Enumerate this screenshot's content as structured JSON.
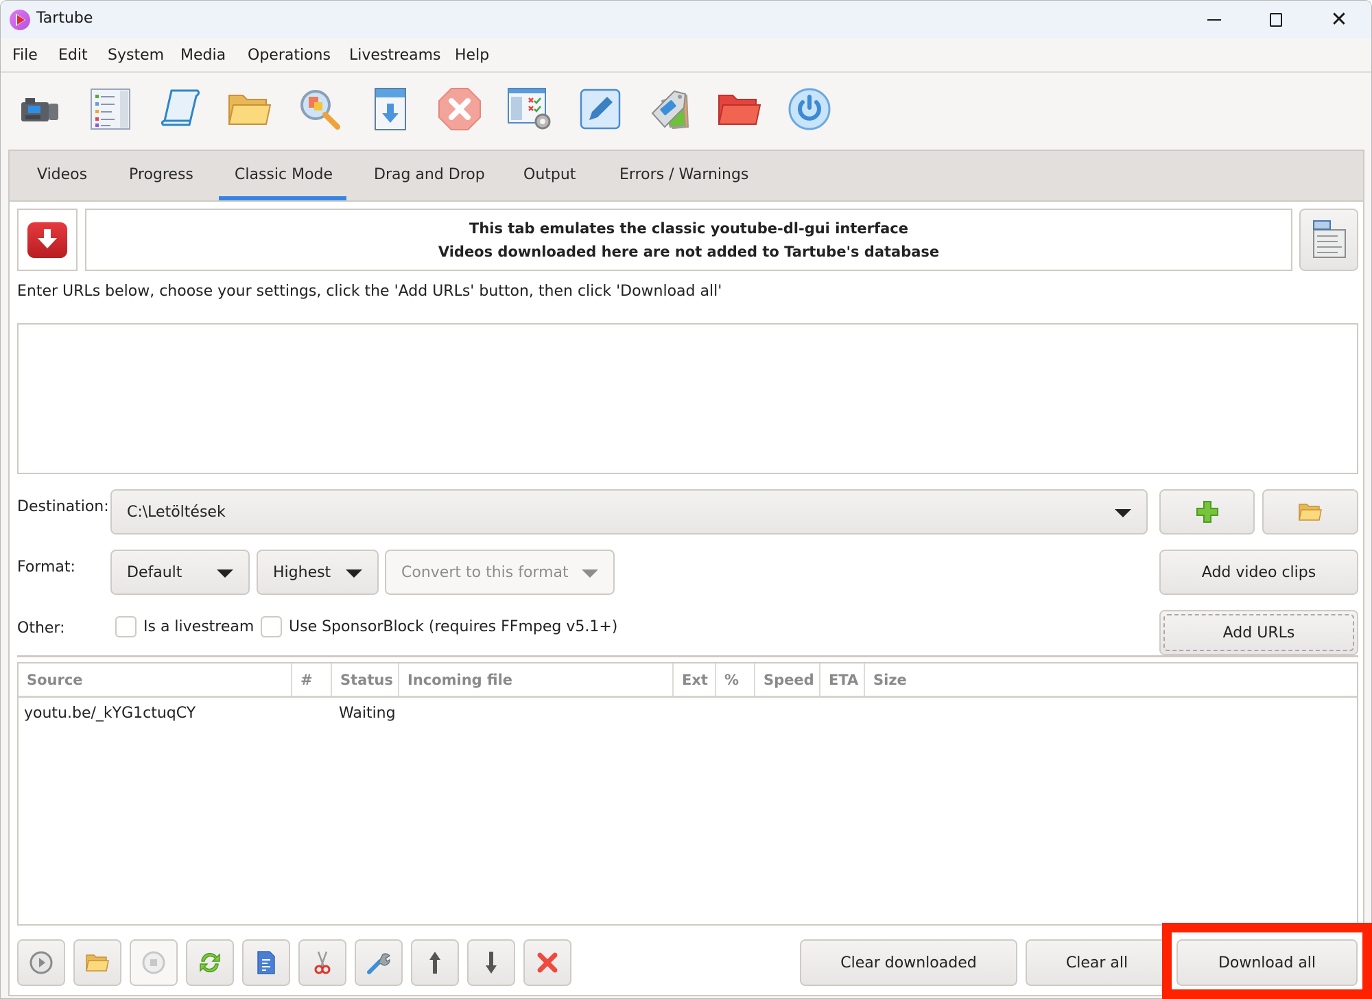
{
  "window": {
    "title": "Tartube",
    "controls": {
      "minimize": "minimize",
      "maximize": "maximize",
      "close": "✕"
    }
  },
  "menubar": [
    "File",
    "Edit",
    "System",
    "Media",
    "Operations",
    "Livestreams",
    "Help"
  ],
  "toolbar": [
    {
      "icon": "video-camera-icon"
    },
    {
      "icon": "video-list-icon"
    },
    {
      "icon": "scroll-icon"
    },
    {
      "icon": "folder-icon"
    },
    {
      "icon": "magnifier-icon"
    },
    {
      "icon": "download-icon"
    },
    {
      "icon": "stop-icon"
    },
    {
      "icon": "checklist-settings-icon"
    },
    {
      "icon": "edit-pencil-icon"
    },
    {
      "icon": "tags-icon"
    },
    {
      "icon": "red-folder-icon"
    },
    {
      "icon": "power-icon"
    }
  ],
  "tabs": [
    {
      "label": "Videos",
      "active": false
    },
    {
      "label": "Progress",
      "active": false
    },
    {
      "label": "Classic Mode",
      "active": true
    },
    {
      "label": "Drag and Drop",
      "active": false
    },
    {
      "label": "Output",
      "active": false
    },
    {
      "label": "Errors / Warnings",
      "active": false
    }
  ],
  "accent_color": "#3584e4",
  "banner": {
    "line1": "This tab emulates the classic youtube-dl-gui interface",
    "line2": "Videos downloaded here are not added to Tartube's database"
  },
  "instructions": "Enter URLs below, choose your settings, click the 'Add URLs' button, then click 'Download all'",
  "url_input": {
    "value": "",
    "placeholder": ""
  },
  "destination": {
    "label": "Destination:",
    "value": "C:\\Letöltések"
  },
  "format": {
    "label": "Format:",
    "format_value": "Default",
    "quality_value": "Highest",
    "convert_placeholder": "Convert to this format"
  },
  "other": {
    "label": "Other:",
    "livestream_label": "Is a livestream",
    "livestream_checked": false,
    "sponsorblock_label": "Use SponsorBlock (requires FFmpeg v5.1+)",
    "sponsorblock_checked": false
  },
  "buttons": {
    "add_video_clips": "Add video clips",
    "add_urls": "Add URLs",
    "clear_downloaded": "Clear downloaded",
    "clear_all": "Clear all",
    "download_all": "Download all"
  },
  "table": {
    "columns": [
      "Source",
      "#",
      "Status",
      "Incoming file",
      "Ext",
      "%",
      "Speed",
      "ETA",
      "Size"
    ],
    "rows": [
      {
        "source": "youtu.be/_kYG1ctuqCY",
        "num": "",
        "status": "Waiting",
        "incoming_file": "",
        "ext": "",
        "percent": "",
        "speed": "",
        "eta": "",
        "size": ""
      }
    ]
  },
  "bottom_toolbar": [
    {
      "icon": "play-icon",
      "enabled": true
    },
    {
      "icon": "open-folder-icon",
      "enabled": true
    },
    {
      "icon": "stop-icon",
      "enabled": false
    },
    {
      "icon": "refresh-icon",
      "enabled": true
    },
    {
      "icon": "document-icon",
      "enabled": true
    },
    {
      "icon": "scissors-icon",
      "enabled": true
    },
    {
      "icon": "wrench-icon",
      "enabled": true
    },
    {
      "icon": "arrow-up-icon",
      "enabled": true
    },
    {
      "icon": "arrow-down-icon",
      "enabled": true
    },
    {
      "icon": "delete-icon",
      "enabled": true
    }
  ],
  "highlight_color": "#ff2200"
}
